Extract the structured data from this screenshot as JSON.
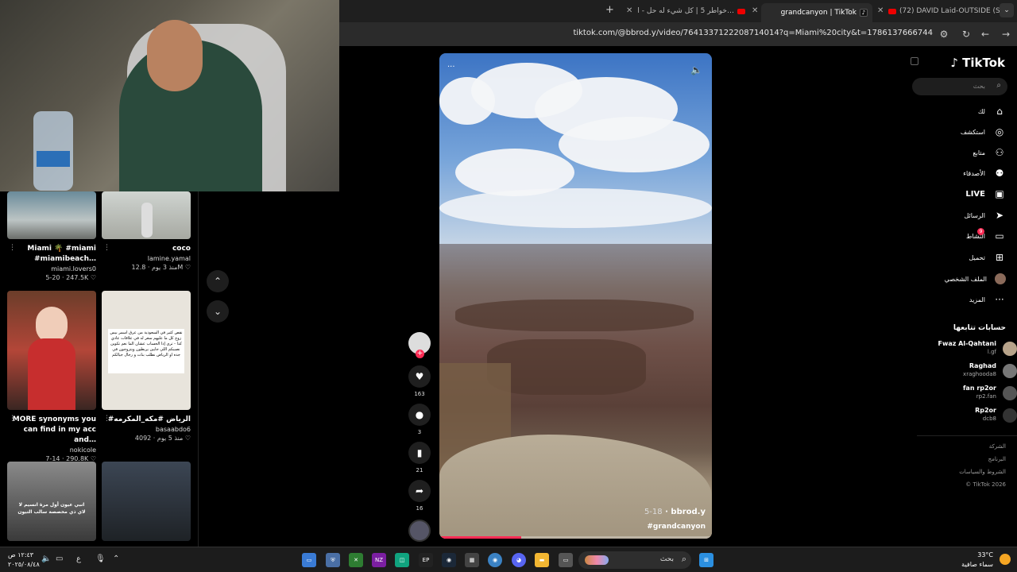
{
  "browser": {
    "tabs": [
      {
        "label": "(72) DAVID Laid-OUTSIDE (SLO…",
        "icon": "youtube-icon"
      },
      {
        "label": "grandcanyon | TikTok",
        "icon": "tiktok-icon",
        "active": true
      },
      {
        "label": "(72) خواطر 5 | كل شيء له حل - ا…",
        "icon": "youtube-icon"
      }
    ],
    "new_tab": "+",
    "url": "tiktok.com/@bbrod.y/video/7641337122208714014?q=Miami%20city&t=1786137666744"
  },
  "feed": {
    "cards": [
      {
        "title": "Miami 🌴 #miami #miamibeach…",
        "user": "miami.lovers0",
        "meta": "5-20 · 247.5K ♡"
      },
      {
        "title": "coco",
        "user": "lamine.yamal",
        "meta": "منذ 3 يوم · 12.8M ♡"
      },
      {
        "title": "MORE synonyms you can find in my acc and…",
        "user": "nokicole",
        "meta": "7-14 · 290.8K ♡"
      },
      {
        "title": "#الرياض #مكه_المكرمه",
        "user": "basaabdo6",
        "meta": "منذ 5 يوم · 4092 ♡"
      },
      {
        "title": "",
        "user": "",
        "meta": ""
      },
      {
        "title": "",
        "user": "",
        "meta": ""
      }
    ],
    "card4_overlay": "نقص كثير في السعودية من عرق اسمر بيس زوج كل ما عليهم سعر له في علاقات عادي كذا - ترى إذا الحساب عشان الما نعم تكوين نصيبكم اللي جايين يربطون ويتزوجون في جده او الرياض نطلب بنات و رجال جيالكم",
    "card5_overlay": "انبي عيون أول مرة انسيم لا لاي ذي مخصصة سالب التيون"
  },
  "video": {
    "username": "bbrod.y",
    "date": "5-18",
    "hashtag": "#grandcanyon",
    "progress": 0.3
  },
  "actions": {
    "likes": "163",
    "comments": "3",
    "saves": "21",
    "shares": "16"
  },
  "sidebar": {
    "logo": "TikTok",
    "search_placeholder": "بحث",
    "nav": [
      {
        "label": "لك",
        "icon": "home-icon"
      },
      {
        "label": "استكشف",
        "icon": "compass-icon"
      },
      {
        "label": "متابع",
        "icon": "user-plus-icon"
      },
      {
        "label": "الأصدقاء",
        "icon": "friends-icon"
      },
      {
        "label": "LIVE",
        "icon": "live-icon"
      },
      {
        "label": "الرسائل",
        "icon": "send-icon"
      },
      {
        "label": "النشاط",
        "icon": "inbox-icon",
        "badge": "9"
      },
      {
        "label": "تحميل",
        "icon": "upload-icon"
      },
      {
        "label": "الملف الشخصي",
        "icon": "avatar-icon"
      },
      {
        "label": "المزيد",
        "icon": "more-icon"
      }
    ],
    "following_title": "حسابات تتابعها",
    "following": [
      {
        "name": "Fwaz Al-Qahtani",
        "user": "l.gf"
      },
      {
        "name": "Raghad",
        "user": "xraghooda8"
      },
      {
        "name": "fan rp2or",
        "user": "rp2.fan"
      },
      {
        "name": "Rp2or",
        "user": "dcb8"
      }
    ],
    "footer": [
      "الشركة",
      "البرنامج",
      "الشروط والسياسات",
      "© TikTok 2026"
    ]
  },
  "taskbar": {
    "time": "١٢:٤٣ ص",
    "date": "٢٠٢٥/٠٨/٤٨",
    "search_placeholder": "بحث",
    "lang": "ع",
    "temp": "33°C",
    "weather": "سماء صافية"
  }
}
